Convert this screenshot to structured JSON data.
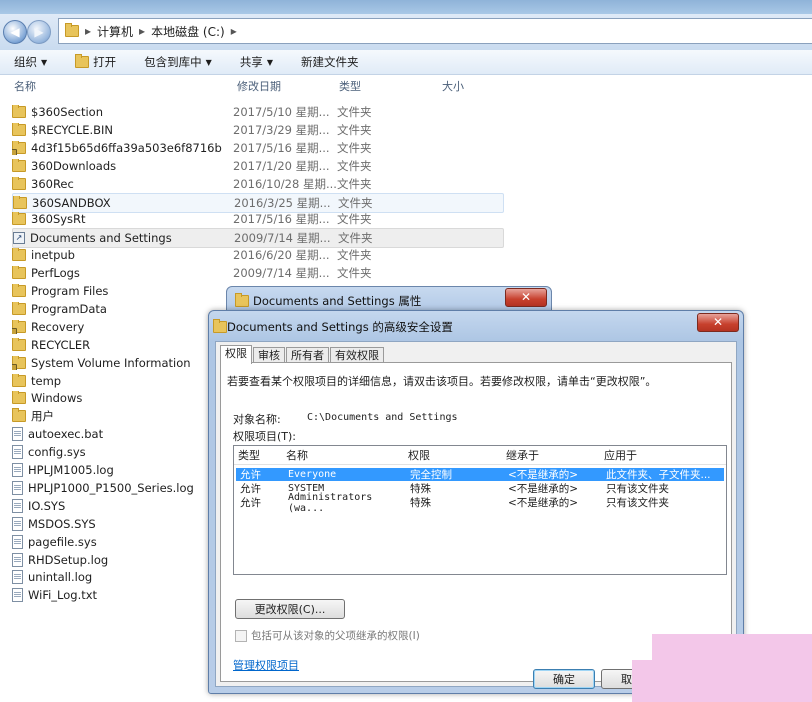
{
  "address": {
    "path": [
      "计算机",
      "本地磁盘 (C:)"
    ]
  },
  "toolbar": {
    "organize": "组织",
    "open": "打开",
    "include_library": "包含到库中",
    "share": "共享",
    "new_folder": "新建文件夹"
  },
  "columns": {
    "name": "名称",
    "date": "修改日期",
    "type": "类型",
    "size": "大小"
  },
  "files": [
    {
      "name": "$360Section",
      "date": "2017/5/10 星期...",
      "type": "文件夹",
      "icon": "folder-icon"
    },
    {
      "name": "$RECYCLE.BIN",
      "date": "2017/3/29 星期...",
      "type": "文件夹",
      "icon": "folder-icon"
    },
    {
      "name": "4d3f15b65d6ffa39a503e6f8716b",
      "date": "2017/5/16 星期...",
      "type": "文件夹",
      "icon": "locked-folder-icon"
    },
    {
      "name": "360Downloads",
      "date": "2017/1/20 星期...",
      "type": "文件夹",
      "icon": "folder-icon"
    },
    {
      "name": "360Rec",
      "date": "2016/10/28 星期...",
      "type": "文件夹",
      "icon": "folder-icon"
    },
    {
      "name": "360SANDBOX",
      "date": "2016/3/25 星期...",
      "type": "文件夹",
      "icon": "folder-icon"
    },
    {
      "name": "360SysRt",
      "date": "2017/5/16 星期...",
      "type": "文件夹",
      "icon": "folder-icon"
    },
    {
      "name": "Documents and Settings",
      "date": "2009/7/14 星期...",
      "type": "文件夹",
      "icon": "shortcut-icon"
    },
    {
      "name": "inetpub",
      "date": "2016/6/20 星期...",
      "type": "文件夹",
      "icon": "folder-icon"
    },
    {
      "name": "PerfLogs",
      "date": "2009/7/14 星期...",
      "type": "文件夹",
      "icon": "folder-icon"
    },
    {
      "name": "Program Files",
      "date": "",
      "type": "",
      "icon": "folder-icon"
    },
    {
      "name": "ProgramData",
      "date": "",
      "type": "",
      "icon": "folder-icon"
    },
    {
      "name": "Recovery",
      "date": "",
      "type": "",
      "icon": "locked-folder-icon"
    },
    {
      "name": "RECYCLER",
      "date": "",
      "type": "",
      "icon": "folder-icon"
    },
    {
      "name": "System Volume Information",
      "date": "",
      "type": "",
      "icon": "locked-folder-icon"
    },
    {
      "name": "temp",
      "date": "",
      "type": "",
      "icon": "folder-icon"
    },
    {
      "name": "Windows",
      "date": "",
      "type": "",
      "icon": "folder-icon"
    },
    {
      "name": "用户",
      "date": "",
      "type": "",
      "icon": "folder-icon"
    },
    {
      "name": "autoexec.bat",
      "date": "",
      "type": "",
      "icon": "file-icon"
    },
    {
      "name": "config.sys",
      "date": "",
      "type": "",
      "icon": "file-icon"
    },
    {
      "name": "HPLJM1005.log",
      "date": "",
      "type": "",
      "icon": "file-icon"
    },
    {
      "name": "HPLJP1000_P1500_Series.log",
      "date": "",
      "type": "",
      "icon": "file-icon"
    },
    {
      "name": "IO.SYS",
      "date": "",
      "type": "",
      "icon": "file-icon"
    },
    {
      "name": "MSDOS.SYS",
      "date": "",
      "type": "",
      "icon": "file-icon"
    },
    {
      "name": "pagefile.sys",
      "date": "",
      "type": "",
      "icon": "file-icon"
    },
    {
      "name": "RHDSetup.log",
      "date": "",
      "type": "",
      "icon": "file-icon"
    },
    {
      "name": "unintall.log",
      "date": "",
      "type": "",
      "icon": "file-icon"
    },
    {
      "name": "WiFi_Log.txt",
      "date": "",
      "type": "",
      "icon": "file-icon"
    }
  ],
  "properties_window": {
    "title": "Documents and Settings 属性"
  },
  "dialog": {
    "title": "Documents and Settings 的高级安全设置",
    "tabs": [
      "权限",
      "审核",
      "所有者",
      "有效权限"
    ],
    "instruction": "若要查看某个权限项目的详细信息，请双击该项目。若要修改权限，请单击“更改权限”。",
    "object_label": "对象名称:",
    "object_value": "C:\\Documents and Settings",
    "entries_label": "权限项目(T):",
    "headers": [
      "类型",
      "名称",
      "权限",
      "继承于",
      "应用于"
    ],
    "entries": [
      {
        "type": "允许",
        "name": "Everyone",
        "permission": "完全控制",
        "inherited": "<不是继承的>",
        "applies": "此文件夹、子文件夹..."
      },
      {
        "type": "允许",
        "name": "SYSTEM",
        "permission": "特殊",
        "inherited": "<不是继承的>",
        "applies": "只有该文件夹"
      },
      {
        "type": "允许",
        "name": "Administrators (wa...",
        "permission": "特殊",
        "inherited": "<不是继承的>",
        "applies": "只有该文件夹"
      }
    ],
    "change_button": "更改权限(C)...",
    "inherit_checkbox": "包括可从该对象的父项继承的权限(I)",
    "manage_link": "管理权限项目",
    "ok": "确定",
    "cancel": "取消"
  },
  "colors": {
    "selection": "#3399ff",
    "link": "#0066cc",
    "close_button": "#c7402d"
  }
}
